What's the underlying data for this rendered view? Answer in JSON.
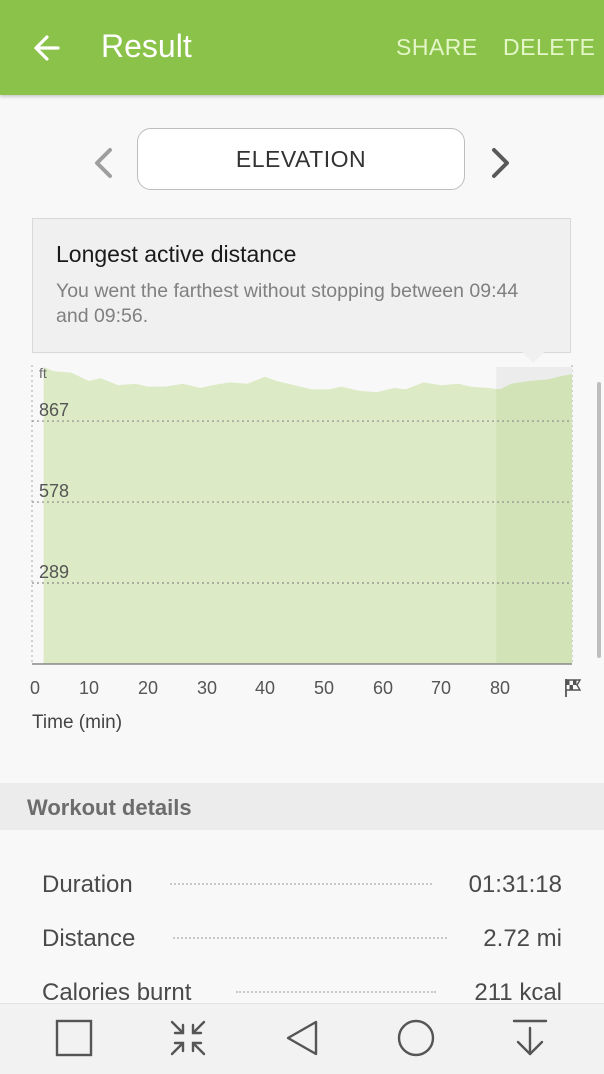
{
  "appbar": {
    "title": "Result",
    "share_label": "SHARE",
    "delete_label": "DELETE",
    "color": "#8bc34a"
  },
  "metric_selector": {
    "current": "ELEVATION"
  },
  "tooltip": {
    "title": "Longest active distance",
    "text": "You went the farthest without stopping between 09:44 and 09:56."
  },
  "chart_data": {
    "type": "area",
    "title": "",
    "ylabel": "ft",
    "xlabel": "Time (min)",
    "ylim": [
      0,
      1060
    ],
    "xlim": [
      0,
      91.3
    ],
    "y_ticks": [
      "289",
      "578",
      "867"
    ],
    "x_ticks": [
      "0",
      "10",
      "20",
      "30",
      "40",
      "50",
      "60",
      "70",
      "80"
    ],
    "end_marker": "finish-flag-icon",
    "highlight_range": [
      78.4,
      91.3
    ],
    "fill_color": "#dceac5",
    "highlight_color": "#d2e3b8",
    "series": [
      {
        "x": [
          1.3,
          3,
          6,
          9,
          11,
          14,
          17,
          19,
          22,
          25,
          28,
          30,
          33,
          36,
          39,
          41,
          44,
          47,
          50,
          52,
          55,
          58,
          61,
          63,
          66,
          69,
          72,
          74,
          77,
          79,
          81,
          84,
          87,
          89,
          91.3
        ],
        "values": [
          1060,
          1045,
          1040,
          1010,
          1020,
          995,
          1000,
          990,
          990,
          1000,
          985,
          995,
          1005,
          1000,
          1025,
          1010,
          995,
          980,
          980,
          990,
          975,
          970,
          985,
          980,
          1005,
          995,
          1000,
          990,
          985,
          980,
          1000,
          1010,
          1015,
          1025,
          1035
        ]
      }
    ]
  },
  "workout": {
    "header": "Workout details",
    "rows": [
      {
        "label": "Duration",
        "value": "01:31:18"
      },
      {
        "label": "Distance",
        "value": "2.72 mi"
      },
      {
        "label": "Calories burnt",
        "value": "211 kcal"
      }
    ]
  },
  "navbar": {
    "icons": [
      "recent-apps-icon",
      "collapse-icon",
      "back-triangle-icon",
      "home-circle-icon",
      "download-arrow-icon"
    ]
  }
}
